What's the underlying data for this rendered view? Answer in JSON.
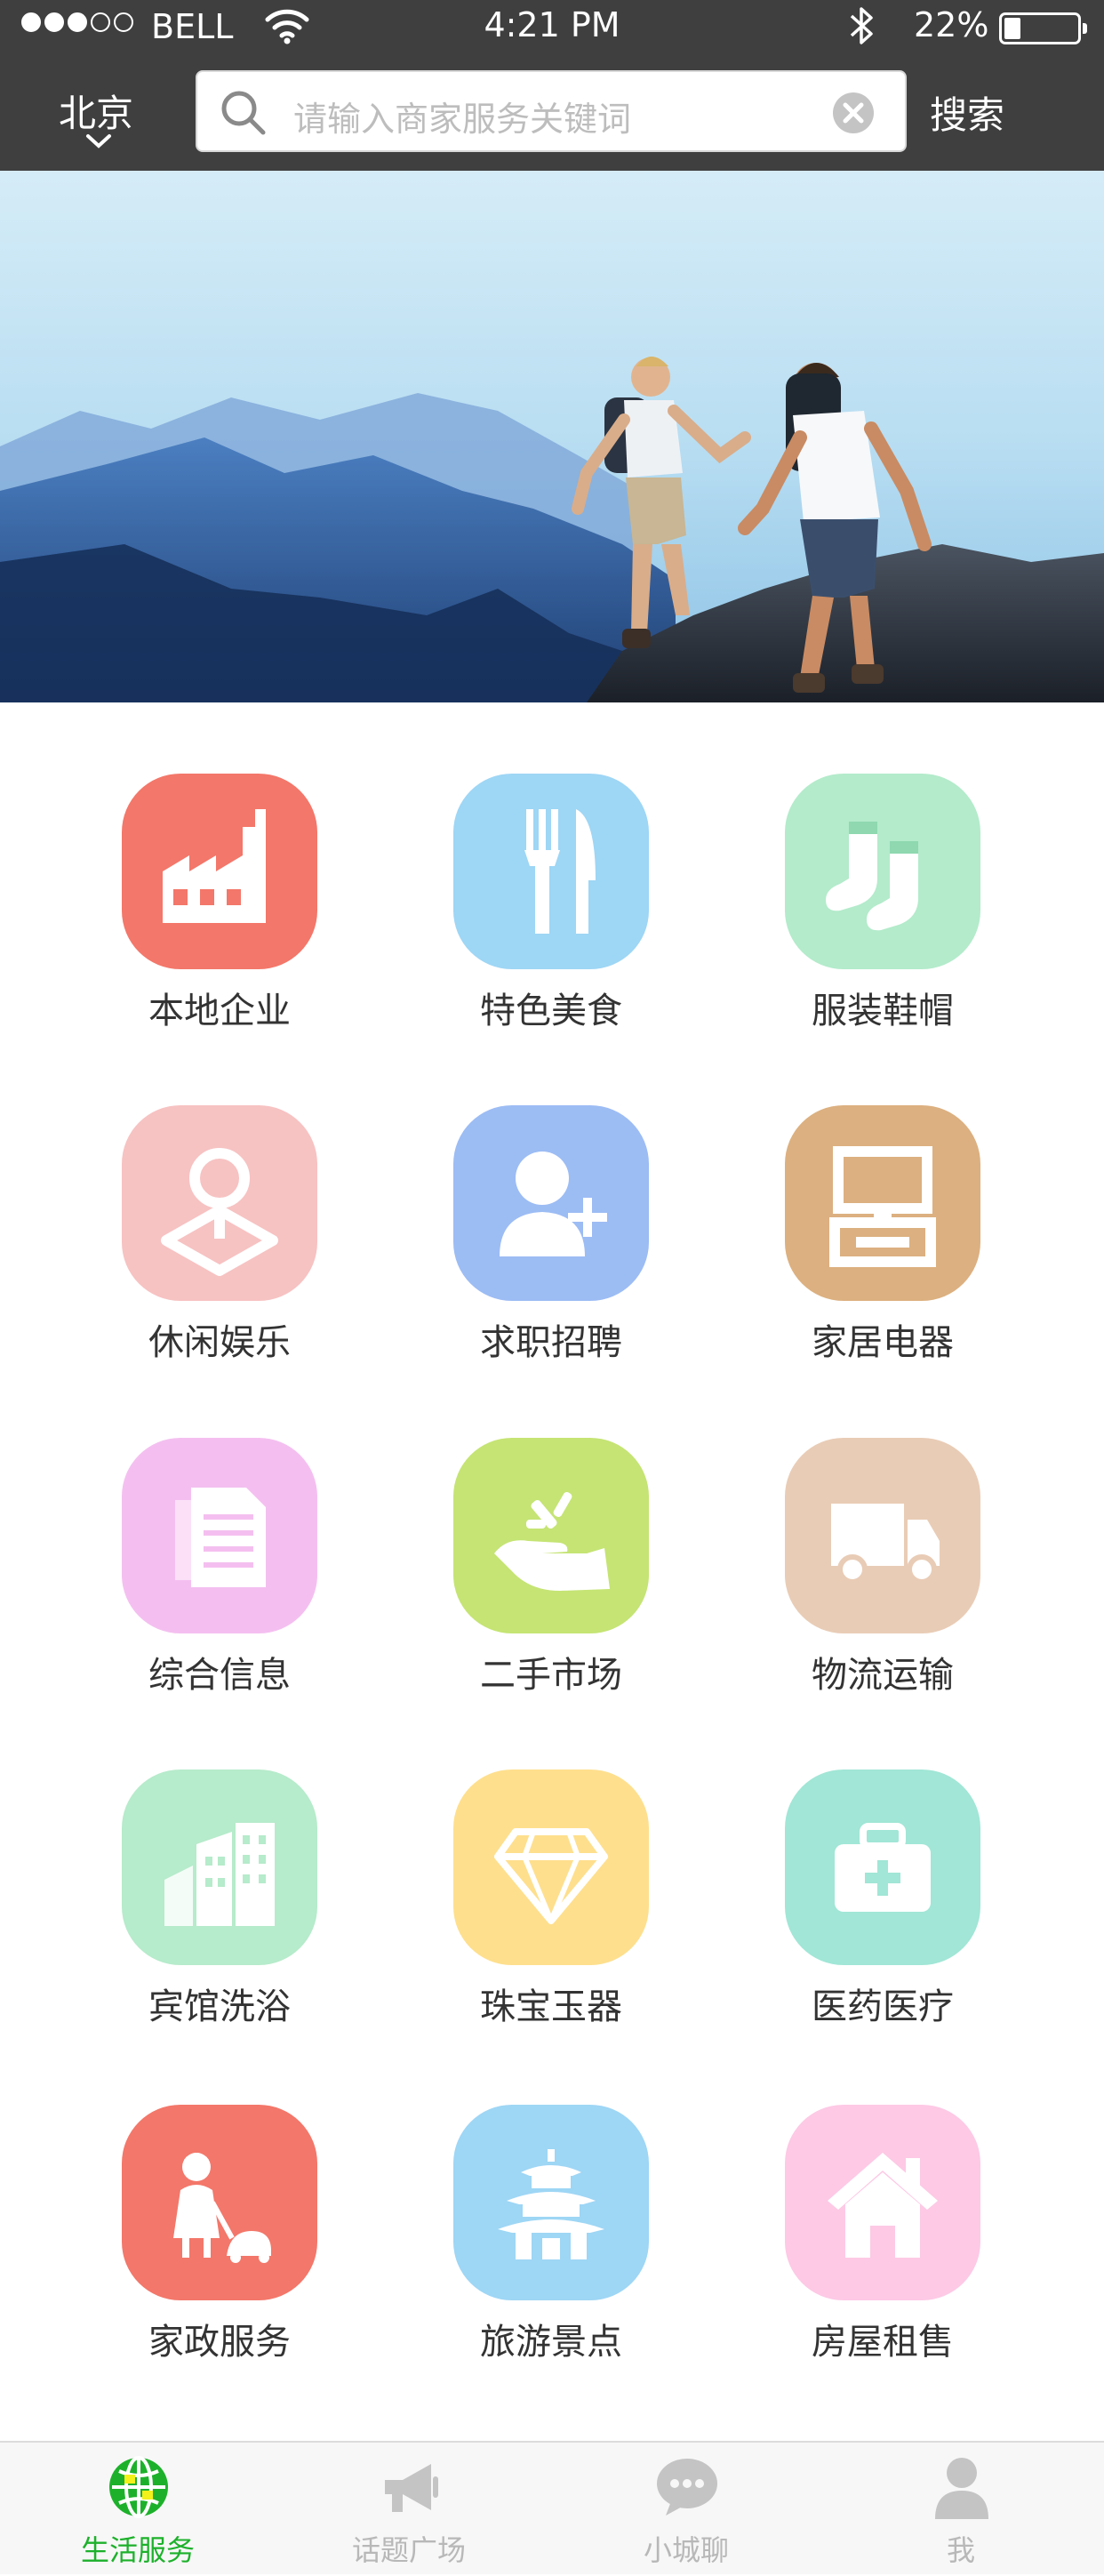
{
  "status_bar": {
    "carrier": "BELL",
    "time": "4:21 PM",
    "battery": "22%",
    "battery_level": 0.22,
    "signal_bars": 3,
    "signal_total": 5
  },
  "header": {
    "city": "北京",
    "search_placeholder": "请输入商家服务关键词",
    "search_button": "搜索"
  },
  "categories": [
    {
      "label": "本地企业",
      "color": "#f3776a",
      "icon": "factory-icon"
    },
    {
      "label": "特色美食",
      "color": "#9ed6f5",
      "icon": "fork-knife-icon"
    },
    {
      "label": "服装鞋帽",
      "color": "#b3ebcb",
      "icon": "socks-icon"
    },
    {
      "label": "休闲娱乐",
      "color": "#f7c2c2",
      "icon": "location-pin-icon"
    },
    {
      "label": "求职招聘",
      "color": "#9cbcf4",
      "icon": "add-user-icon"
    },
    {
      "label": "家居电器",
      "color": "#dcb080",
      "icon": "appliance-icon"
    },
    {
      "label": "综合信息",
      "color": "#f4bff0",
      "icon": "document-icon"
    },
    {
      "label": "二手市场",
      "color": "#c5e474",
      "icon": "hand-icon"
    },
    {
      "label": "物流运输",
      "color": "#e9ccb6",
      "icon": "truck-icon"
    },
    {
      "label": "宾馆洗浴",
      "color": "#b6ebcb",
      "icon": "building-icon"
    },
    {
      "label": "珠宝玉器",
      "color": "#fedf8d",
      "icon": "diamond-icon"
    },
    {
      "label": "医药医疗",
      "color": "#a1e6d6",
      "icon": "medical-kit-icon"
    },
    {
      "label": "家政服务",
      "color": "#f3776a",
      "icon": "housekeeping-icon"
    },
    {
      "label": "旅游景点",
      "color": "#9ed6f5",
      "icon": "pagoda-icon"
    },
    {
      "label": "房屋租售",
      "color": "#fdc9e5",
      "icon": "house-icon"
    }
  ],
  "tabs": [
    {
      "label": "生活服务",
      "active": true,
      "icon": "globe-icon"
    },
    {
      "label": "话题广场",
      "active": false,
      "icon": "megaphone-icon"
    },
    {
      "label": "小城聊",
      "active": false,
      "icon": "chat-bubble-icon"
    },
    {
      "label": "我",
      "active": false,
      "icon": "person-icon"
    }
  ],
  "colors": {
    "header_bg": "#3f3f3f",
    "active_tab": "#1db12b",
    "inactive_tab": "#b8b8b8"
  }
}
